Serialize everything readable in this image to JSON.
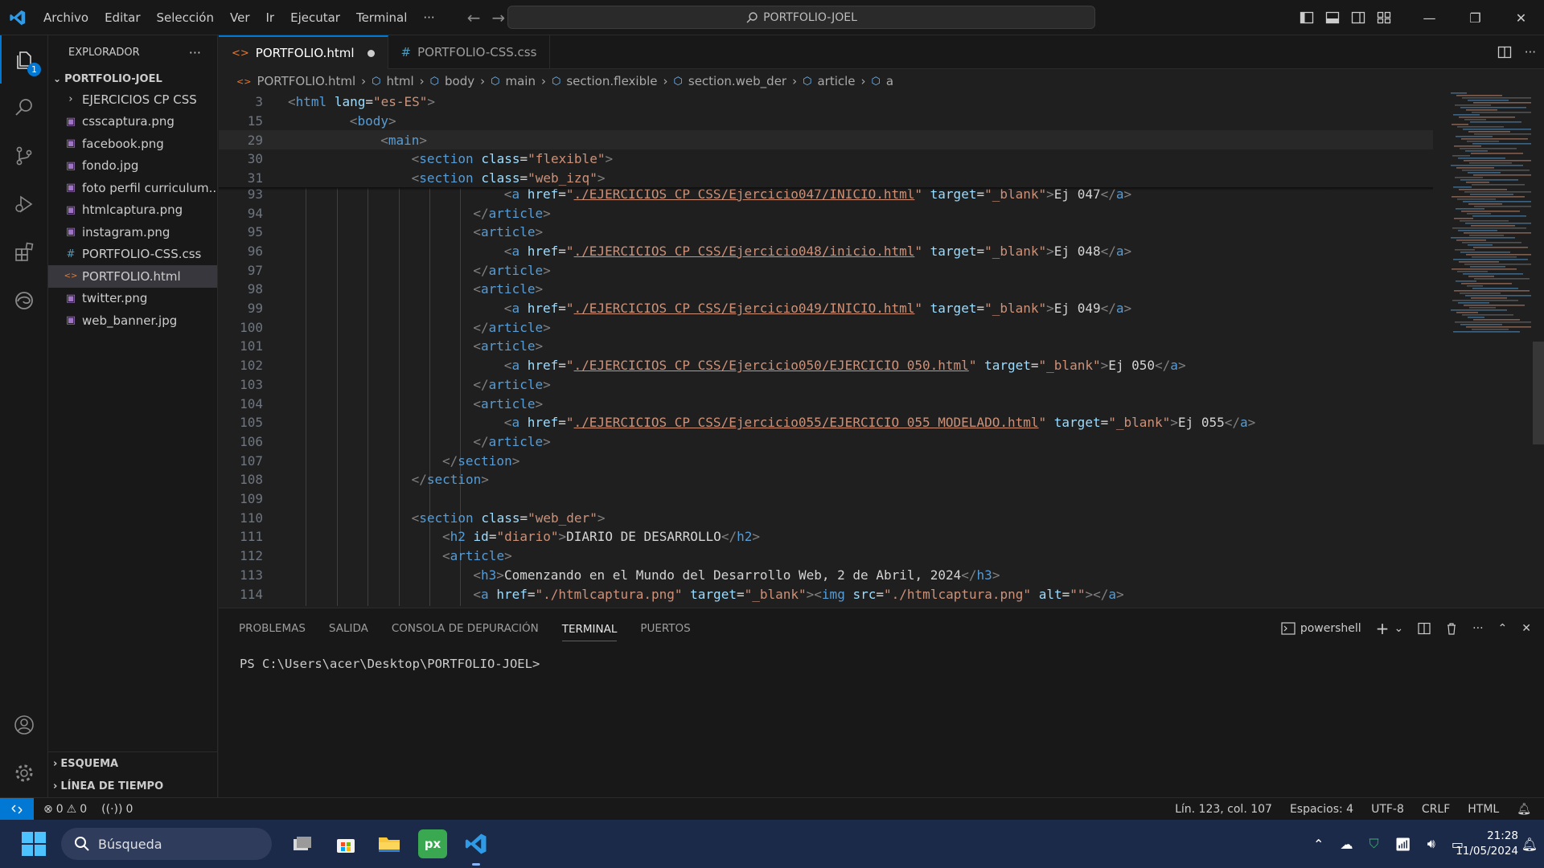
{
  "titlebar": {
    "menu": [
      "Archivo",
      "Editar",
      "Selección",
      "Ver",
      "Ir",
      "Ejecutar",
      "Terminal",
      "···"
    ],
    "search": "PORTFOLIO-JOEL"
  },
  "activitybar": {
    "explorer_badge": "1"
  },
  "sidebar": {
    "title": "EXPLORADOR",
    "more": "···",
    "root": "PORTFOLIO-JOEL",
    "items": [
      {
        "label": "EJERCICIOS CP CSS",
        "icon": "folder-chevron-icon"
      },
      {
        "label": "csscaptura.png",
        "icon": "image-icon"
      },
      {
        "label": "facebook.png",
        "icon": "image-icon"
      },
      {
        "label": "fondo.jpg",
        "icon": "image-icon"
      },
      {
        "label": "foto perfil curriculum....",
        "icon": "image-icon"
      },
      {
        "label": "htmlcaptura.png",
        "icon": "image-icon"
      },
      {
        "label": "instagram.png",
        "icon": "image-icon"
      },
      {
        "label": "PORTFOLIO-CSS.css",
        "icon": "css-icon"
      },
      {
        "label": "PORTFOLIO.html",
        "icon": "html-icon"
      },
      {
        "label": "twitter.png",
        "icon": "image-icon"
      },
      {
        "label": "web_banner.jpg",
        "icon": "image-icon"
      }
    ],
    "outline": "ESQUEMA",
    "timeline": "LÍNEA DE TIEMPO"
  },
  "tabs": [
    {
      "label": "PORTFOLIO.html",
      "icon": "<>",
      "active": true
    },
    {
      "label": "PORTFOLIO-CSS.css",
      "icon": "#",
      "active": false
    }
  ],
  "breadcrumb": [
    "PORTFOLIO.html",
    "html",
    "body",
    "main",
    "section.flexible",
    "section.web_der",
    "article",
    "a"
  ],
  "code": {
    "sticky": [
      {
        "n": "3",
        "html": "<span class='t'>&lt;</span><span class='tn'>html</span> <span class='an'>lang</span><span class='tx'>=</span><span class='av'>\"es-ES\"</span><span class='t'>&gt;</span>",
        "indent": 0
      },
      {
        "n": "15",
        "html": "<span class='t'>&lt;</span><span class='tn'>body</span><span class='t'>&gt;</span>",
        "indent": 2
      },
      {
        "n": "29",
        "html": "<span class='t'>&lt;</span><span class='tn'>main</span><span class='t'>&gt;</span>",
        "indent": 3
      },
      {
        "n": "30",
        "html": "<span class='t'>&lt;</span><span class='tn'>section</span> <span class='an'>class</span><span class='tx'>=</span><span class='av'>\"flexible\"</span><span class='t'>&gt;</span>",
        "indent": 4
      },
      {
        "n": "31",
        "html": "<span class='t'>&lt;</span><span class='tn'>section</span> <span class='an'>class</span><span class='tx'>=</span><span class='av'>\"web_izq\"</span><span class='t'>&gt;</span>",
        "indent": 4
      }
    ],
    "lines": [
      {
        "n": "93",
        "indent": 7,
        "html": "<span class='t'>&lt;</span><span class='tn'>a</span> <span class='an'>href</span><span class='tx'>=</span><span class='av'>\"<span class='ul'>./EJERCICIOS CP CSS/Ejercicio047/INICIO.html</span>\"</span> <span class='an'>target</span><span class='tx'>=</span><span class='av'>\"_blank\"</span><span class='t'>&gt;</span><span class='tx'>Ej 047</span><span class='t'>&lt;/</span><span class='tn'>a</span><span class='t'>&gt;</span>"
      },
      {
        "n": "94",
        "indent": 6,
        "html": "<span class='t'>&lt;/</span><span class='tn'>article</span><span class='t'>&gt;</span>"
      },
      {
        "n": "95",
        "indent": 6,
        "html": "<span class='t'>&lt;</span><span class='tn'>article</span><span class='t'>&gt;</span>"
      },
      {
        "n": "96",
        "indent": 7,
        "html": "<span class='t'>&lt;</span><span class='tn'>a</span> <span class='an'>href</span><span class='tx'>=</span><span class='av'>\"<span class='ul'>./EJERCICIOS CP CSS/Ejercicio048/inicio.html</span>\"</span> <span class='an'>target</span><span class='tx'>=</span><span class='av'>\"_blank\"</span><span class='t'>&gt;</span><span class='tx'>Ej 048</span><span class='t'>&lt;/</span><span class='tn'>a</span><span class='t'>&gt;</span>"
      },
      {
        "n": "97",
        "indent": 6,
        "html": "<span class='t'>&lt;/</span><span class='tn'>article</span><span class='t'>&gt;</span>"
      },
      {
        "n": "98",
        "indent": 6,
        "html": "<span class='t'>&lt;</span><span class='tn'>article</span><span class='t'>&gt;</span>"
      },
      {
        "n": "99",
        "indent": 7,
        "html": "<span class='t'>&lt;</span><span class='tn'>a</span> <span class='an'>href</span><span class='tx'>=</span><span class='av'>\"<span class='ul'>./EJERCICIOS CP CSS/Ejercicio049/INICIO.html</span>\"</span> <span class='an'>target</span><span class='tx'>=</span><span class='av'>\"_blank\"</span><span class='t'>&gt;</span><span class='tx'>Ej 049</span><span class='t'>&lt;/</span><span class='tn'>a</span><span class='t'>&gt;</span>"
      },
      {
        "n": "100",
        "indent": 6,
        "html": "<span class='t'>&lt;/</span><span class='tn'>article</span><span class='t'>&gt;</span>"
      },
      {
        "n": "101",
        "indent": 6,
        "html": "<span class='t'>&lt;</span><span class='tn'>article</span><span class='t'>&gt;</span>"
      },
      {
        "n": "102",
        "indent": 7,
        "html": "<span class='t'>&lt;</span><span class='tn'>a</span> <span class='an'>href</span><span class='tx'>=</span><span class='av'>\"<span class='ul'>./EJERCICIOS CP CSS/Ejercicio050/EJERCICIO 050.html</span>\"</span> <span class='an'>target</span><span class='tx'>=</span><span class='av'>\"_blank\"</span><span class='t'>&gt;</span><span class='tx'>Ej 050</span><span class='t'>&lt;/</span><span class='tn'>a</span><span class='t'>&gt;</span>"
      },
      {
        "n": "103",
        "indent": 6,
        "html": "<span class='t'>&lt;/</span><span class='tn'>article</span><span class='t'>&gt;</span>"
      },
      {
        "n": "104",
        "indent": 6,
        "html": "<span class='t'>&lt;</span><span class='tn'>article</span><span class='t'>&gt;</span>"
      },
      {
        "n": "105",
        "indent": 7,
        "html": "<span class='t'>&lt;</span><span class='tn'>a</span> <span class='an'>href</span><span class='tx'>=</span><span class='av'>\"<span class='ul'>./EJERCICIOS CP CSS/Ejercicio055/EJERCICIO 055 MODELADO.html</span>\"</span> <span class='an'>target</span><span class='tx'>=</span><span class='av'>\"_blank\"</span><span class='t'>&gt;</span><span class='tx'>Ej 055</span><span class='t'>&lt;/</span><span class='tn'>a</span><span class='t'>&gt;</span>"
      },
      {
        "n": "106",
        "indent": 6,
        "html": "<span class='t'>&lt;/</span><span class='tn'>article</span><span class='t'>&gt;</span>"
      },
      {
        "n": "107",
        "indent": 5,
        "html": "<span class='t'>&lt;/</span><span class='tn'>section</span><span class='t'>&gt;</span>"
      },
      {
        "n": "108",
        "indent": 4,
        "html": "<span class='t'>&lt;/</span><span class='tn'>section</span><span class='t'>&gt;</span>"
      },
      {
        "n": "109",
        "indent": 0,
        "html": ""
      },
      {
        "n": "110",
        "indent": 4,
        "html": "<span class='t'>&lt;</span><span class='tn'>section</span> <span class='an'>class</span><span class='tx'>=</span><span class='av'>\"web_der\"</span><span class='t'>&gt;</span>"
      },
      {
        "n": "111",
        "indent": 5,
        "html": "<span class='t'>&lt;</span><span class='tn'>h2</span> <span class='an'>id</span><span class='tx'>=</span><span class='av'>\"diario\"</span><span class='t'>&gt;</span><span class='tx'>DIARIO DE DESARROLLO</span><span class='t'>&lt;/</span><span class='tn'>h2</span><span class='t'>&gt;</span>"
      },
      {
        "n": "112",
        "indent": 5,
        "html": "<span class='t'>&lt;</span><span class='tn'>article</span><span class='t'>&gt;</span>"
      },
      {
        "n": "113",
        "indent": 6,
        "html": "<span class='t'>&lt;</span><span class='tn'>h3</span><span class='t'>&gt;</span><span class='tx'>Comenzando en el Mundo del Desarrollo Web, 2 de Abril, 2024</span><span class='t'>&lt;/</span><span class='tn'>h3</span><span class='t'>&gt;</span>"
      },
      {
        "n": "114",
        "indent": 6,
        "html": "<span class='t'>&lt;</span><span class='tn'>a</span> <span class='an'>href</span><span class='tx'>=</span><span class='av'>\"./htmlcaptura.png\"</span> <span class='an'>target</span><span class='tx'>=</span><span class='av'>\"_blank\"</span><span class='t'>&gt;&lt;</span><span class='tn'>img</span> <span class='an'>src</span><span class='tx'>=</span><span class='av'>\"./htmlcaptura.png\"</span> <span class='an'>alt</span><span class='tx'>=</span><span class='av'>\"\"</span><span class='t'>&gt;&lt;/</span><span class='tn'>a</span><span class='t'>&gt;</span>"
      }
    ]
  },
  "panel": {
    "tabs": [
      "PROBLEMAS",
      "SALIDA",
      "CONSOLA DE DEPURACIÓN",
      "TERMINAL",
      "PUERTOS"
    ],
    "active_tab": "TERMINAL",
    "shell": "powershell",
    "prompt": "PS C:\\Users\\acer\\Desktop\\PORTFOLIO-JOEL>"
  },
  "statusbar": {
    "errors": "0",
    "warnings": "0",
    "ports": "0",
    "position": "Lín. 123, col. 107",
    "spaces": "Espacios: 4",
    "encoding": "UTF-8",
    "eol": "CRLF",
    "language": "HTML"
  },
  "taskbar": {
    "search": "Búsqueda",
    "time": "21:28",
    "date": "11/05/2024"
  },
  "colors": {
    "accent": "#0078d4",
    "tag": "#569cd6",
    "attr": "#9cdcfe",
    "string": "#ce9178"
  }
}
